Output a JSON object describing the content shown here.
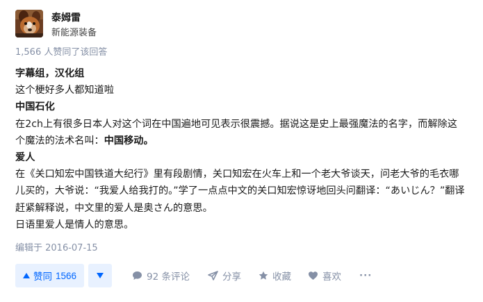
{
  "author": {
    "name": "泰姆雷",
    "headline": "新能源装备",
    "avatar_icon": "dog-photo-avatar"
  },
  "vote_summary": "1,566 人赞同了该回答",
  "content": {
    "h1": "字幕组，汉化组",
    "p1": "这个梗好多人都知道啦",
    "h2": "中国石化",
    "p2": "在2ch上有很多日本人对这个词在中国遍地可见表示很震撼。据说这是史上最强魔法的名字，而解除这个魔法的法术名叫：",
    "p2_bold": "中国移动。",
    "h3": "爱人",
    "p3a": "在《关口知宏中国铁道大纪行》里有段剧情，关口知宏在火车上和一个老大爷谈天，问老大爷的毛衣哪儿买的，大爷说：“我爱人给我打的。”学了一点点中文的关口知宏惊讶地回头问翻译：“あいじん？”翻译赶紧解释说，中文里的爱人是奥さん的意思。",
    "p4": "日语里爱人是情人的意思。"
  },
  "edit_time": "编辑于 2016-07-15",
  "actions": {
    "vote_up_label": "赞同",
    "vote_up_count": "1566",
    "comments": "92 条评论",
    "share": "分享",
    "collect": "收藏",
    "like": "喜欢",
    "more": "···"
  },
  "colors": {
    "accent": "#0066ff",
    "accent_bg": "#e8f1ff",
    "muted": "#8590a6"
  }
}
